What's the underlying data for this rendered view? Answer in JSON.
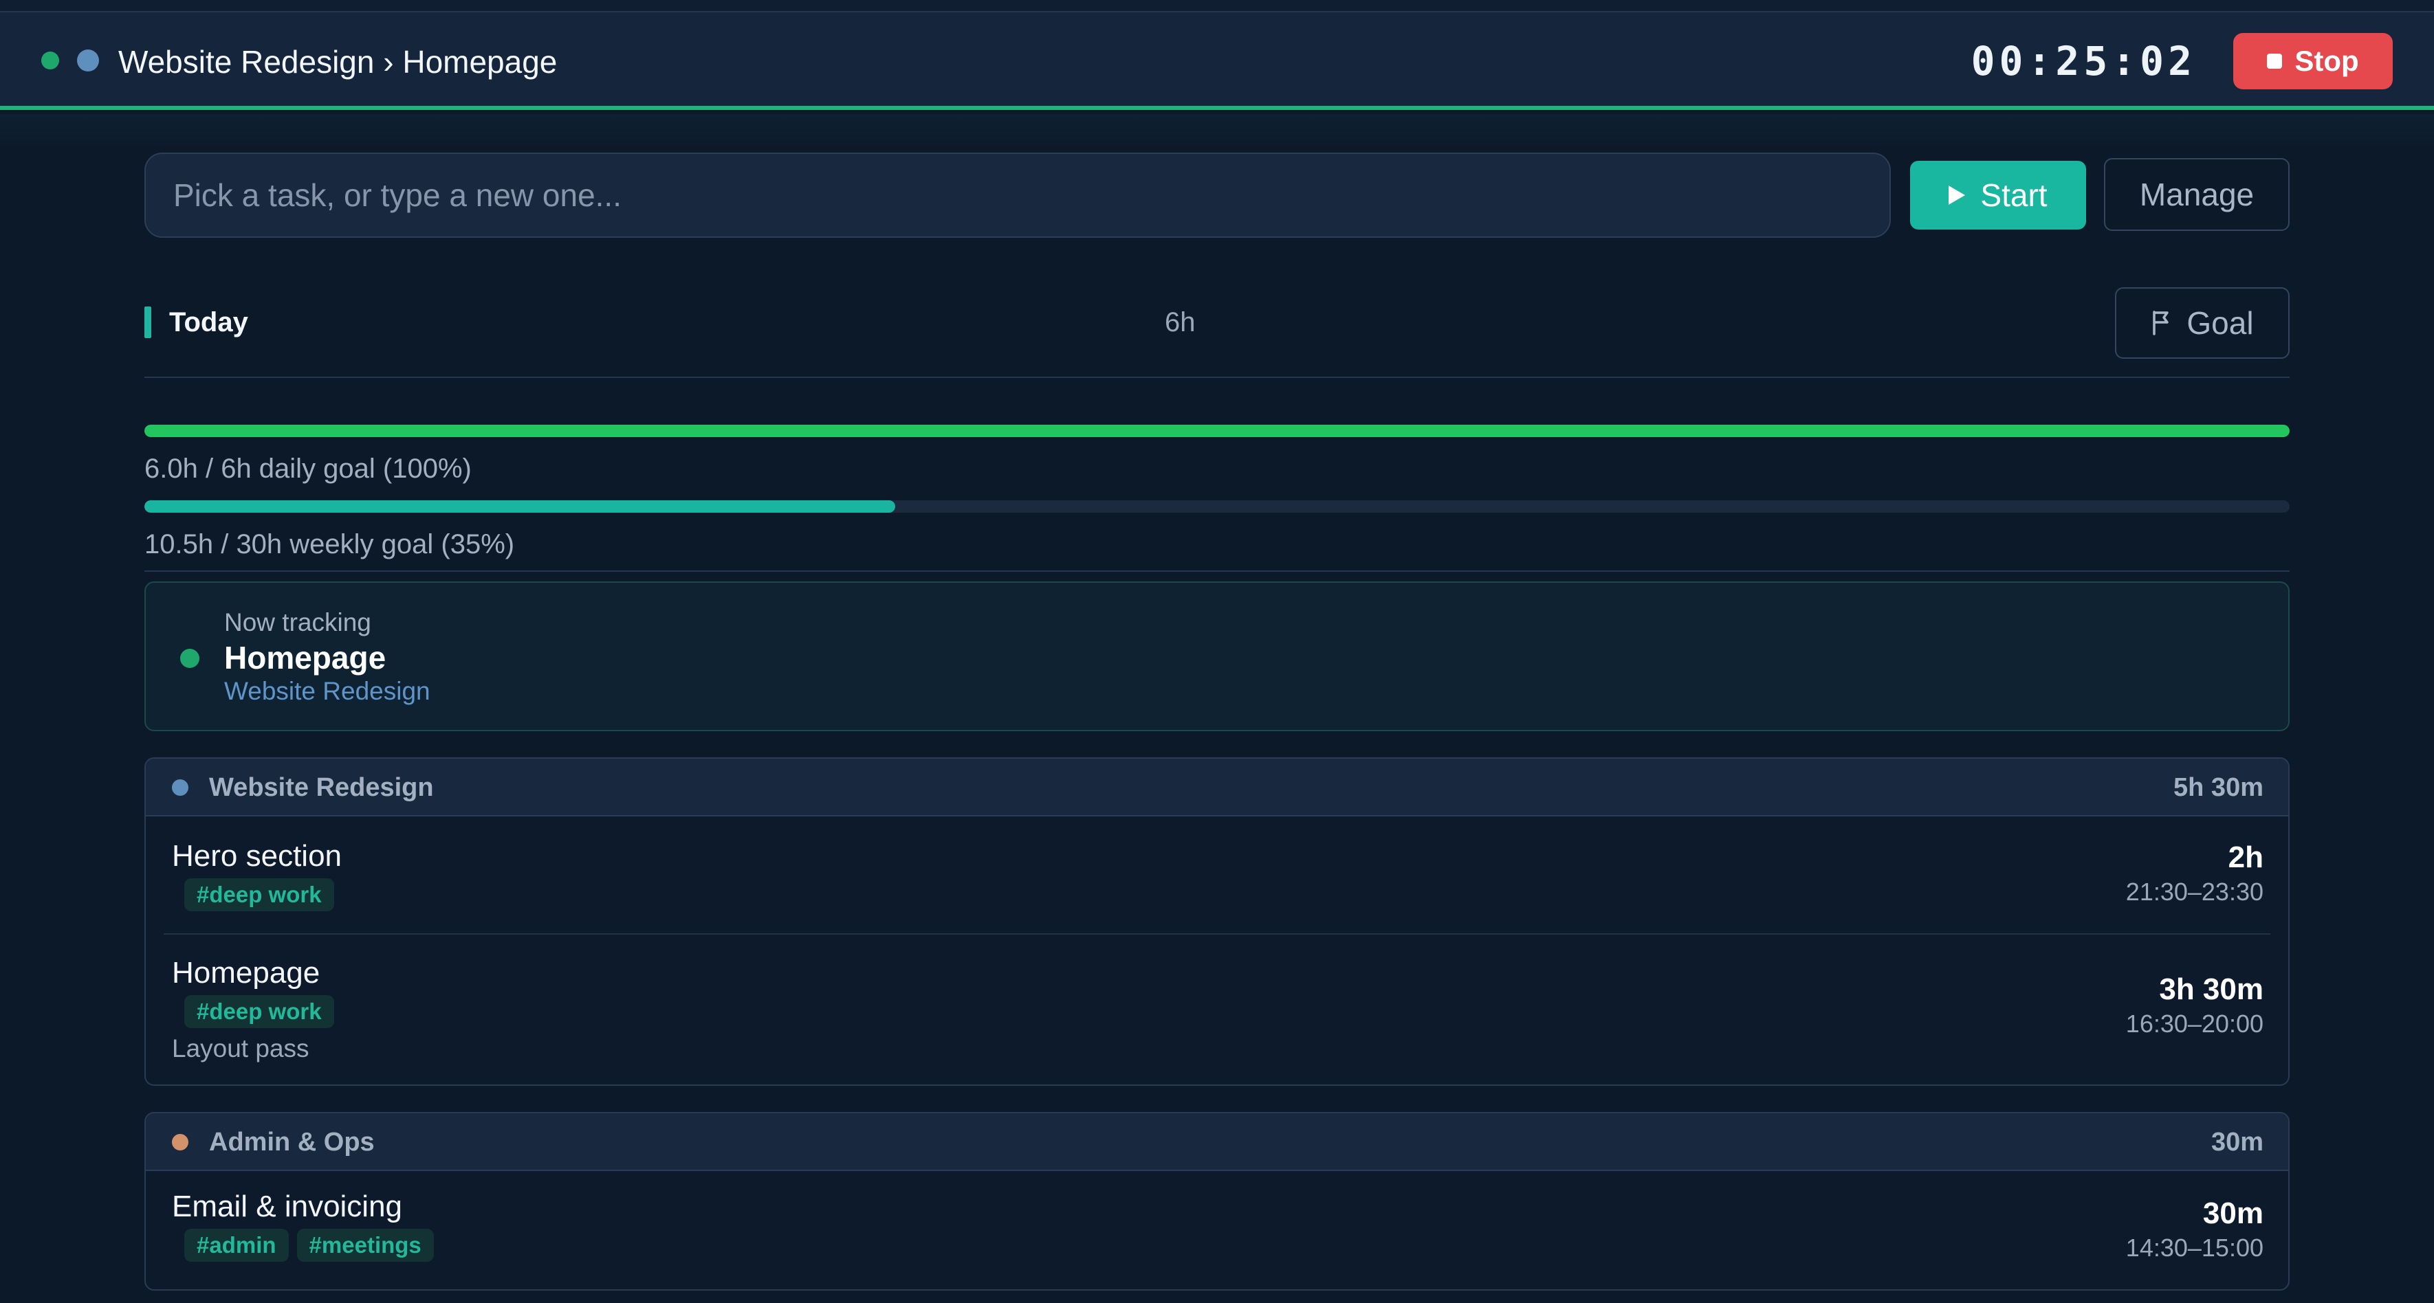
{
  "header": {
    "breadcrumb": "Website Redesign › Homepage",
    "timer": "00:25:02",
    "stop_label": "Stop",
    "status_color": "#1fa86b",
    "project_color": "#5f8fbd"
  },
  "task_bar": {
    "placeholder": "Pick a task, or type a new one...",
    "start_label": "Start",
    "manage_label": "Manage"
  },
  "today": {
    "label": "Today",
    "hours": "6h",
    "goal_label": "Goal"
  },
  "goals": {
    "daily": {
      "label": "6.0h / 6h daily goal (100%)",
      "progress": 1.0,
      "color": "#22c55e"
    },
    "weekly": {
      "label": "10.5h / 30h weekly goal (35%)",
      "progress": 0.35,
      "color": "#1ab5a0"
    }
  },
  "now_tracking": {
    "label": "Now tracking",
    "task": "Homepage",
    "project": "Website Redesign"
  },
  "groups": [
    {
      "name": "Website Redesign",
      "total": "5h 30m",
      "color": "#5f8fbd",
      "entries": [
        {
          "title": "Hero section",
          "tags": [
            "#deep work"
          ],
          "note": "",
          "duration": "2h",
          "time_range": "21:30–23:30"
        },
        {
          "title": "Homepage",
          "tags": [
            "#deep work"
          ],
          "note": "Layout pass",
          "duration": "3h 30m",
          "time_range": "16:30–20:00"
        }
      ]
    },
    {
      "name": "Admin & Ops",
      "total": "30m",
      "color": "#d4926a",
      "entries": [
        {
          "title": "Email & invoicing",
          "tags": [
            "#admin",
            "#meetings"
          ],
          "note": "",
          "duration": "30m",
          "time_range": "14:30–15:00"
        }
      ]
    }
  ]
}
